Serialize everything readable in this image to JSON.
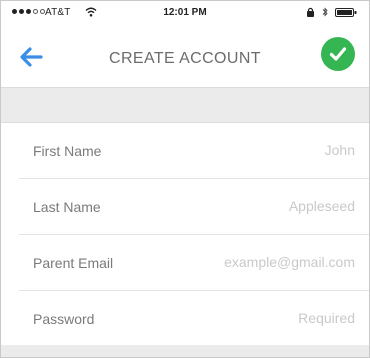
{
  "status_bar": {
    "carrier": "AT&T",
    "time": "12:01 PM"
  },
  "nav": {
    "title": "CREATE ACCOUNT",
    "back_icon": "arrow-left-icon",
    "confirm_icon": "checkmark-icon"
  },
  "form": {
    "fields": [
      {
        "label": "First Name",
        "placeholder": "John"
      },
      {
        "label": "Last Name",
        "placeholder": "Appleseed"
      },
      {
        "label": "Parent Email",
        "placeholder": "example@gmail.com"
      },
      {
        "label": "Password",
        "placeholder": "Required"
      }
    ]
  },
  "colors": {
    "accent_blue": "#3a8ee6",
    "confirm_green": "#35b653",
    "label_gray": "#7a7a7a",
    "placeholder_gray": "#c9c9c9",
    "section_background": "#ebebeb"
  }
}
